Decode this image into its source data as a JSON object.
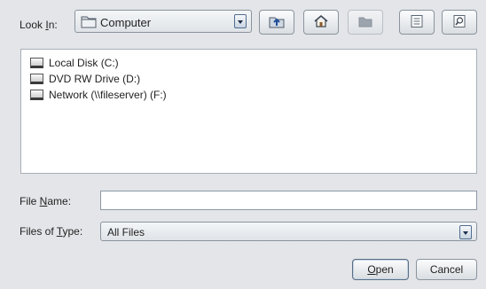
{
  "look_in": {
    "label_pre": "Look ",
    "label_mnemonic": "I",
    "label_post": "n:",
    "selected": "Computer",
    "icon": "folder-icon"
  },
  "toolbar": [
    {
      "name": "up-one-level-button",
      "icon": "up-folder-icon",
      "enabled": true
    },
    {
      "name": "home-button",
      "icon": "home-icon",
      "enabled": true
    },
    {
      "name": "new-folder-button",
      "icon": "new-folder-icon",
      "enabled": false
    },
    {
      "name": "list-view-button",
      "icon": "list-view-icon",
      "enabled": true
    },
    {
      "name": "details-view-button",
      "icon": "details-view-icon",
      "enabled": true
    }
  ],
  "files": [
    {
      "label": "Local Disk (C:)",
      "icon": "hard-drive-icon"
    },
    {
      "label": "DVD RW Drive (D:)",
      "icon": "dvd-drive-icon"
    },
    {
      "label": "Network (\\\\fileserver) (F:)",
      "icon": "network-drive-icon"
    }
  ],
  "file_name": {
    "label_pre": "File ",
    "label_mnemonic": "N",
    "label_post": "ame:",
    "value": ""
  },
  "file_type": {
    "label_pre": "Files of ",
    "label_mnemonic": "T",
    "label_post": "ype:",
    "selected": "All Files"
  },
  "buttons": {
    "open_mnemonic": "O",
    "open_rest": "pen",
    "cancel": "Cancel"
  }
}
